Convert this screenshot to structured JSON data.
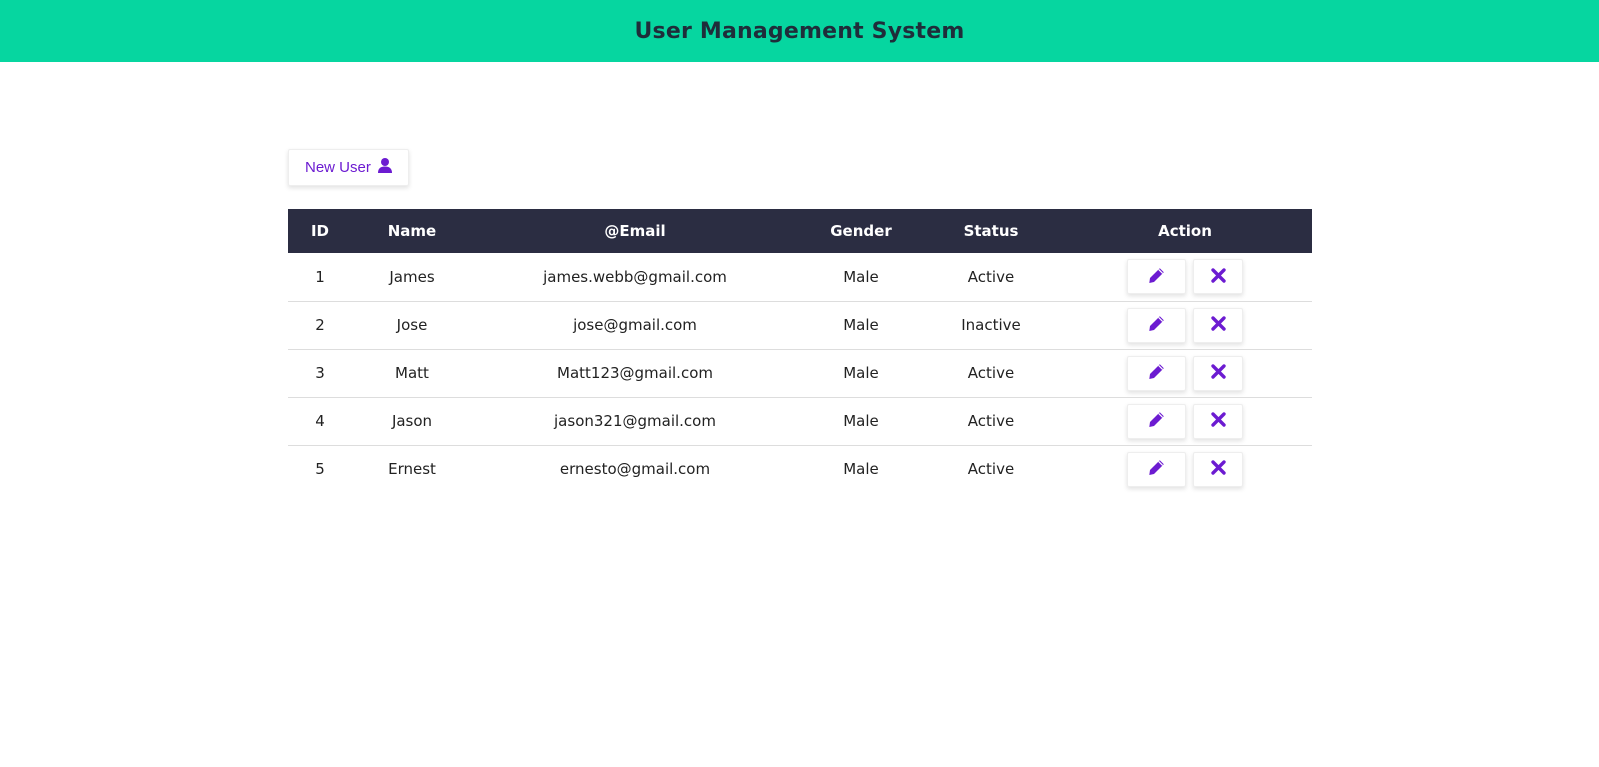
{
  "header": {
    "title": "User Management System"
  },
  "toolbar": {
    "new_user_label": "New User",
    "new_user_icon": "user-icon"
  },
  "colors": {
    "header_bg": "#06d6a0",
    "table_header_bg": "#2b2d42",
    "accent": "#6c1bd1"
  },
  "table": {
    "columns": [
      "ID",
      "Name",
      "@Email",
      "Gender",
      "Status",
      "Action"
    ],
    "rows": [
      {
        "id": "1",
        "name": "James",
        "email": "james.webb@gmail.com",
        "gender": "Male",
        "status": "Active"
      },
      {
        "id": "2",
        "name": "Jose",
        "email": "jose@gmail.com",
        "gender": "Male",
        "status": "Inactive"
      },
      {
        "id": "3",
        "name": "Matt",
        "email": "Matt123@gmail.com",
        "gender": "Male",
        "status": "Active"
      },
      {
        "id": "4",
        "name": "Jason",
        "email": "jason321@gmail.com",
        "gender": "Male",
        "status": "Active"
      },
      {
        "id": "5",
        "name": "Ernest",
        "email": "ernesto@gmail.com",
        "gender": "Male",
        "status": "Active"
      }
    ],
    "row_actions": [
      "pencil-icon",
      "close-icon"
    ]
  }
}
